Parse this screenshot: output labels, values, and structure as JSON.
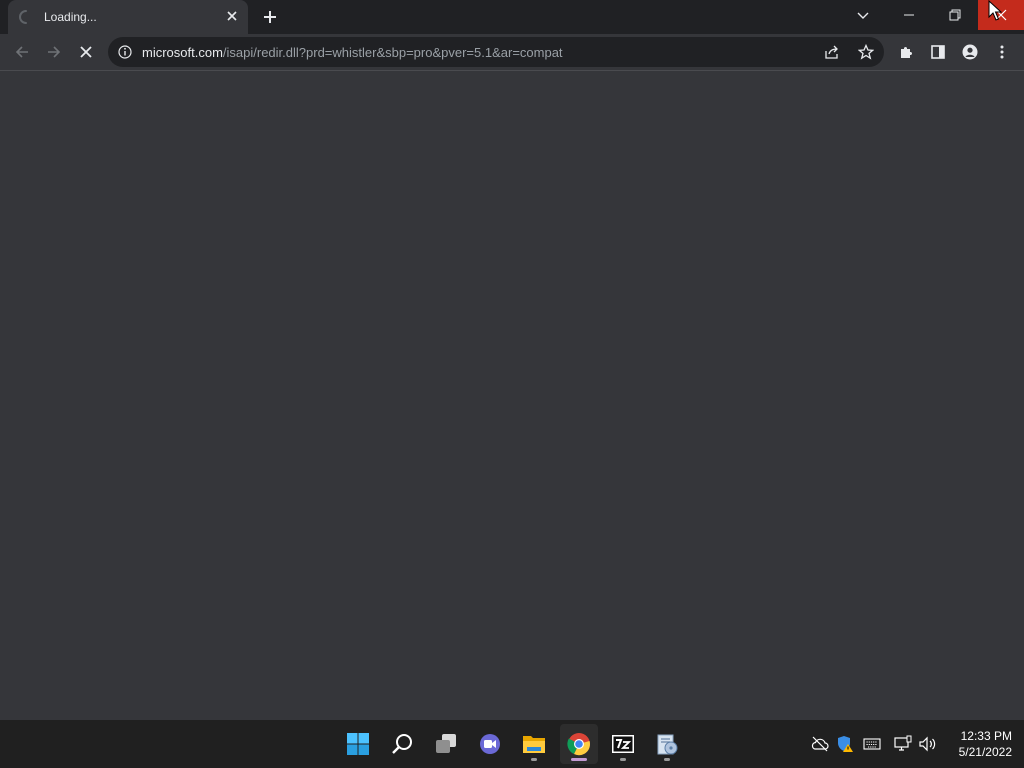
{
  "browser": {
    "tab": {
      "title": "Loading..."
    },
    "address_bar": {
      "url_host": "microsoft.com",
      "url_path": "/isapi/redir.dll?prd=whistler&sbp=pro&pver=5.1&ar=compat"
    }
  },
  "taskbar": {
    "clock": {
      "time": "12:33 PM",
      "date": "5/21/2022"
    },
    "pinned": [
      "start-icon",
      "search-icon",
      "task-view-icon",
      "teams-chat-icon",
      "file-explorer-icon",
      "chrome-icon",
      "7zip-icon",
      "installer-icon"
    ],
    "active_app": "chrome-icon",
    "tray": [
      "cloud-offline-icon",
      "security-warning-icon",
      "keyboard-icon",
      "network-icon",
      "volume-icon"
    ]
  },
  "colors": {
    "titlebar": "#202124",
    "toolbar": "#35363a",
    "omnibox": "#202124",
    "close_hover": "#c42b1c",
    "taskbar": "#202020"
  }
}
